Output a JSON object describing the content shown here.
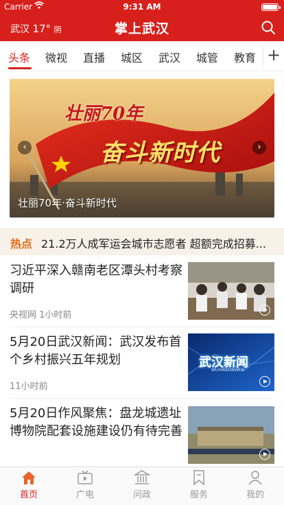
{
  "status_bar": {
    "carrier": "Carrier",
    "time": "9:31 AM",
    "battery_level": 1.0
  },
  "header": {
    "city": "武汉",
    "temperature": "17°",
    "condition": "阴",
    "title": "掌上武汉",
    "search_icon": "search-icon"
  },
  "category_tabs": {
    "items": [
      "头条",
      "微视",
      "直播",
      "城区",
      "武汉",
      "城管",
      "教育"
    ],
    "active_index": 0,
    "add_label": "+"
  },
  "banner": {
    "image_text_top": "壮丽70年",
    "image_text_slogan": "奋斗新时代",
    "caption": "壮丽70年·奋斗新时代",
    "prev_icon": "chevron-left-icon",
    "next_icon": "chevron-right-icon"
  },
  "hot": {
    "label": "热点",
    "text": "21.2万人成军运会城市志愿者 超额完成招募..."
  },
  "news": [
    {
      "headline": "习近平深入赣南老区潭头村考察调研",
      "source": "央视网",
      "time": "1小时前",
      "has_video": true
    },
    {
      "headline": "5月20日武汉新闻：武汉发布首个乡村振兴五年规划",
      "source": "",
      "time": "11小时前",
      "has_video": true,
      "thumb_text": "武汉新闻",
      "thumb_subtext": "WUHANXINWEN"
    },
    {
      "headline": "5月20日作风聚焦：盘龙城遗址博物院配套设施建设仍有待完善",
      "source": "",
      "time": "",
      "has_video": true
    }
  ],
  "bottom_tabs": [
    {
      "label": "首页",
      "icon": "home-icon",
      "active": true
    },
    {
      "label": "广电",
      "icon": "tv-icon",
      "active": false
    },
    {
      "label": "问政",
      "icon": "government-building-icon",
      "active": false
    },
    {
      "label": "服务",
      "icon": "bookmark-icon",
      "active": false
    },
    {
      "label": "我的",
      "icon": "user-icon",
      "active": false
    }
  ],
  "colors": {
    "brand_red": "#d7201c",
    "hot_orange": "#e06a17",
    "hot_background": "#f8f1e7"
  }
}
